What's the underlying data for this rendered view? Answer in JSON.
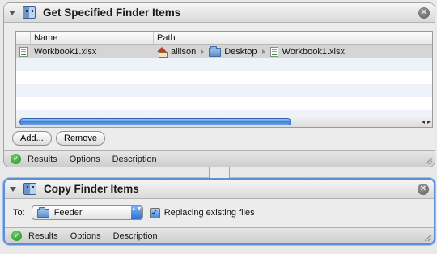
{
  "action1": {
    "title": "Get Specified Finder Items",
    "close_glyph": "✕",
    "table": {
      "col_name": "Name",
      "col_path": "Path",
      "rows": [
        {
          "name": "Workbook1.xlsx",
          "path": [
            "allison",
            "Desktop",
            "Workbook1.xlsx"
          ]
        }
      ]
    },
    "scroll_left_glyph": "◂",
    "scroll_right_glyph": "▸",
    "add_label": "Add...",
    "remove_label": "Remove",
    "footer": {
      "results": "Results",
      "options": "Options",
      "description": "Description"
    }
  },
  "action2": {
    "title": "Copy Finder Items",
    "close_glyph": "✕",
    "to_label": "To:",
    "destination": "Feeder",
    "replacing_label": "Replacing existing files",
    "replacing_checked": true,
    "footer": {
      "results": "Results",
      "options": "Options",
      "description": "Description"
    }
  },
  "icons": {
    "check": "✓",
    "checkbox_mark": "✓",
    "popup_arrows": "▲▼"
  },
  "colors": {
    "selection_border": "#5b8fd6",
    "scroll_thumb": "#3f7fd6",
    "status_ok": "#1d8a1d"
  }
}
